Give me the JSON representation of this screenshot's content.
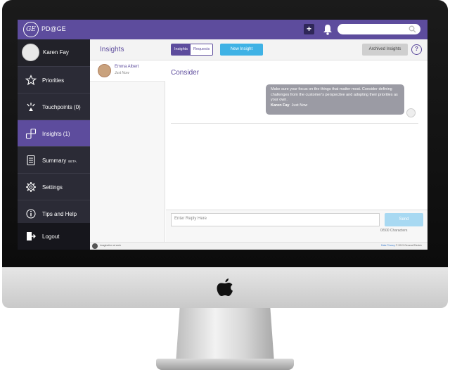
{
  "app": {
    "logo_text": "GE",
    "name": "PD@GE"
  },
  "topbar": {
    "add_icon_glyph": "+",
    "search": {
      "placeholder": ""
    }
  },
  "profile": {
    "name": "Karen Fay"
  },
  "sidebar": {
    "items": [
      {
        "label": "Priorities",
        "icon": "star-icon"
      },
      {
        "label": "Touchpoints (0)",
        "icon": "touchpoint-icon"
      },
      {
        "label": "Insights (1)",
        "icon": "insights-icon",
        "active": true
      },
      {
        "label": "Summary",
        "badge": "BETA",
        "icon": "summary-icon"
      },
      {
        "label": "Settings",
        "icon": "gear-icon"
      },
      {
        "label": "Tips and Help",
        "icon": "info-icon"
      }
    ],
    "logout_label": "Logout",
    "collapse_glyph": "‹"
  },
  "header": {
    "title": "Insights",
    "tabs": [
      "Insights",
      "Requests"
    ],
    "new_button": "New Insight",
    "archived_button": "Archived Insights",
    "help_glyph": "?"
  },
  "list": {
    "items": [
      {
        "name": "Emma Albert",
        "time": "Just Now"
      }
    ]
  },
  "detail": {
    "title": "Consider",
    "message": {
      "text": "Make sure your focus on the things that matter most. Consider defining challenges from the customer's perspective and adopting their priorities as your own.",
      "author": "Karen Fay",
      "time": "Just Now"
    },
    "reply": {
      "placeholder": "Enter Reply Here",
      "send_label": "Send",
      "char_count": "0/500 Characters"
    }
  },
  "footer": {
    "left": "imagination at work",
    "privacy": "Data Privacy",
    "copyright": "© 2013 General Electric"
  },
  "colors": {
    "brand": "#5d4c9d",
    "accent": "#3fb2e5",
    "sidebar": "#2b2b36"
  }
}
